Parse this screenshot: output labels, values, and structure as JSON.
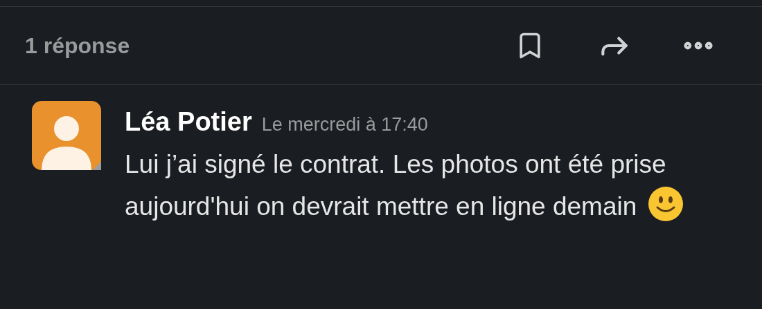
{
  "thread_header": {
    "reply_count": "1 réponse"
  },
  "message": {
    "author": "Léa Potier",
    "timestamp": "Le mercredi à 17:40",
    "text": "Lui j’ai signé le contrat. Les photos ont été prise aujourd'hui on devrait mettre en ligne demain"
  }
}
